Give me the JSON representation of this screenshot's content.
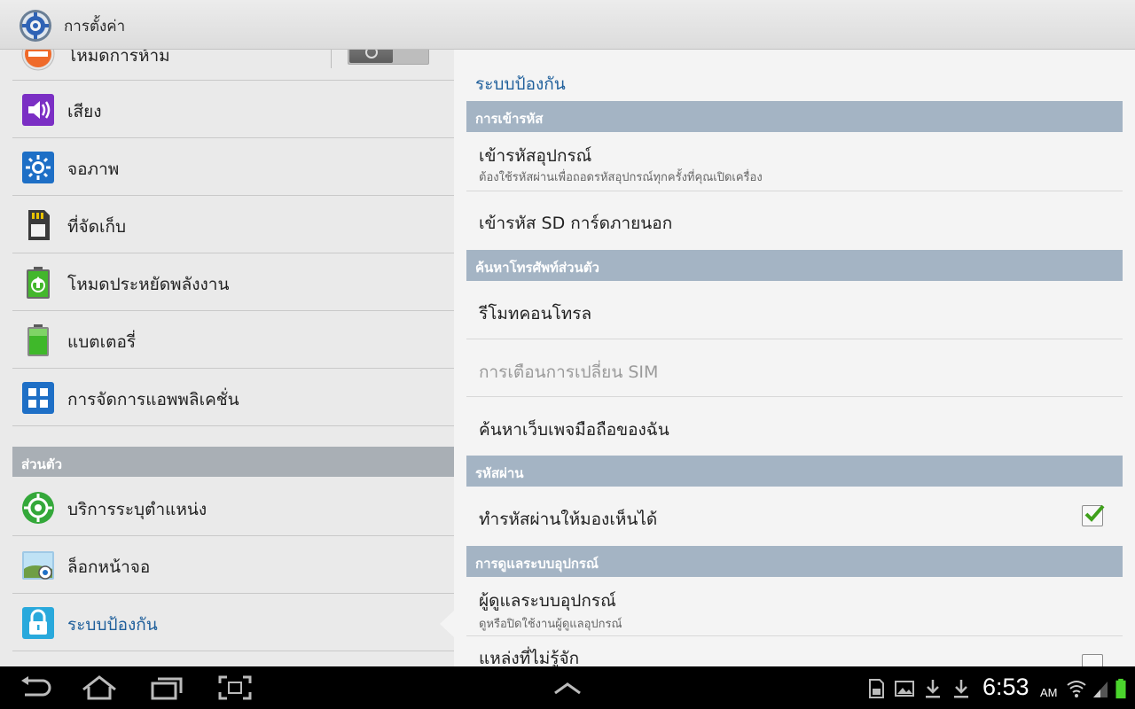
{
  "app": {
    "title": "การตั้งค่า"
  },
  "left": {
    "items_top": [
      {
        "label": "โหมดการห้าม",
        "icon": "block-icon"
      },
      {
        "label": "เสียง",
        "icon": "volume-icon"
      },
      {
        "label": "จอภาพ",
        "icon": "brightness-icon"
      },
      {
        "label": "ที่จัดเก็บ",
        "icon": "sd-card-icon"
      },
      {
        "label": "โหมดประหยัดพลังงาน",
        "icon": "power-saving-icon"
      },
      {
        "label": "แบตเตอรี่",
        "icon": "battery-icon"
      },
      {
        "label": "การจัดการแอพพลิเคชั่น",
        "icon": "apps-icon"
      }
    ],
    "section": "ส่วนตัว",
    "items_personal": [
      {
        "label": "บริการระบุตำแหน่ง",
        "icon": "location-icon"
      },
      {
        "label": "ล็อกหน้าจอ",
        "icon": "lock-screen-icon"
      },
      {
        "label": "ระบบป้องกัน",
        "icon": "padlock-icon"
      }
    ],
    "blocking_mode_on": false
  },
  "right": {
    "page_title": "ระบบป้องกัน",
    "cat_encryption": "การเข้ารหัส",
    "encrypt_device": {
      "title": "เข้ารหัสอุปกรณ์",
      "summary": "ต้องใช้รหัสผ่านเพื่อถอดรหัสอุปกรณ์ทุกครั้งที่คุณเปิดเครื่อง"
    },
    "encrypt_sd": {
      "title": "เข้ารหัส SD การ์ดภายนอก"
    },
    "cat_find": "ค้นหาโทรศัพท์ส่วนตัว",
    "remote_control": {
      "title": "รีโมทคอนโทรล"
    },
    "sim_alert": {
      "title": "การเตือนการเปลี่ยน SIM"
    },
    "find_web": {
      "title": "ค้นหาเว็บเพจมือถือของฉัน"
    },
    "cat_password": "รหัสผ่าน",
    "show_password": {
      "title": "ทำรหัสผ่านให้มองเห็นได้",
      "checked": true
    },
    "cat_admin": "การดูแลระบบอุปกรณ์",
    "device_admin": {
      "title": "ผู้ดูแลระบบอุปกรณ์",
      "summary": "ดูหรือปิดใช้งานผู้ดูแลอุปกรณ์"
    },
    "unknown_sources": {
      "title": "แหล่งที่ไม่รู้จัก",
      "checked": false
    }
  },
  "status": {
    "time": "6:53",
    "ampm": "AM"
  },
  "colors": {
    "accent": "#1f5f9b",
    "category": "#a4b4c4",
    "checkmark": "#3fa01b"
  }
}
